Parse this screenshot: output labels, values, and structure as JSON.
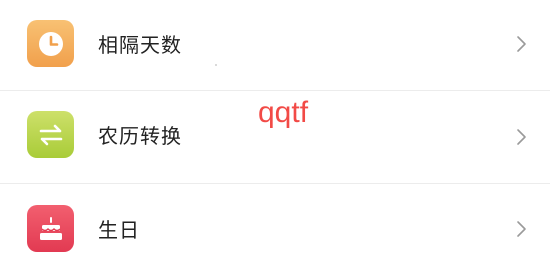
{
  "list": {
    "items": [
      {
        "label": "相隔天数",
        "icon": "clock-icon",
        "icon_gradient": [
          "#f8c173",
          "#f1a04c"
        ]
      },
      {
        "label": "农历转换",
        "icon": "swap-arrows-icon",
        "icon_gradient": [
          "#cde06a",
          "#a9cc38"
        ]
      },
      {
        "label": "生日",
        "icon": "birthday-cake-icon",
        "icon_gradient": [
          "#f25f6f",
          "#e23a52"
        ]
      }
    ]
  },
  "overlay": {
    "text": "qqtf",
    "color": "#f24a46"
  },
  "chevron_color": "#9a9a9a",
  "divider_color": "#ececec"
}
